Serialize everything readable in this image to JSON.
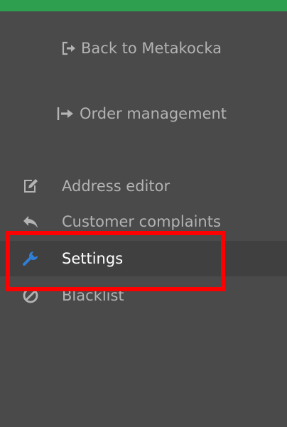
{
  "colors": {
    "top_bar": "#2e9e4f",
    "background": "#4a4a4a",
    "text": "#b3b3b3",
    "active_text": "#ffffff",
    "active_icon": "#2f7fd6",
    "highlight_border": "#ff0000"
  },
  "top_links": [
    {
      "label": "Back to Metakocka",
      "icon": "sign-out-icon"
    },
    {
      "label": "Order management",
      "icon": "sign-in-icon"
    }
  ],
  "menu": {
    "items": [
      {
        "label": "Address editor",
        "icon": "edit-icon"
      },
      {
        "label": "Customer complaints",
        "icon": "reply-icon"
      },
      {
        "label": "Settings",
        "icon": "wrench-icon",
        "active": true
      },
      {
        "label": "Blacklist",
        "icon": "ban-icon"
      }
    ]
  }
}
